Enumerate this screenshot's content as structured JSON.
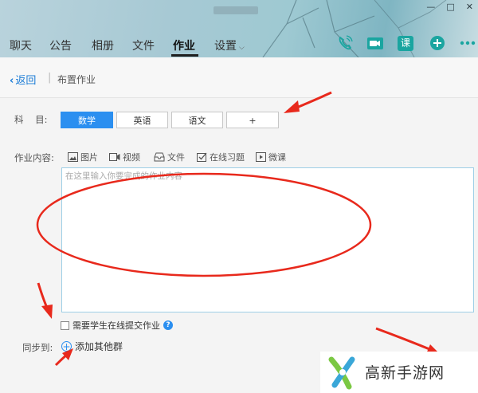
{
  "window": {
    "title_blurred": "",
    "controls": [
      "—",
      "□",
      "✕"
    ]
  },
  "nav": {
    "tabs": [
      {
        "label": "聊天"
      },
      {
        "label": "公告"
      },
      {
        "label": "相册"
      },
      {
        "label": "文件"
      },
      {
        "label": "作业"
      },
      {
        "label": "设置"
      }
    ],
    "active_tab": "作业",
    "tool_icons": [
      "phone-icon",
      "video-call-icon",
      "class-icon",
      "add-icon",
      "more-icon"
    ],
    "class_icon_label": "课"
  },
  "breadcrumb": {
    "back_label": "返回",
    "separator": "|",
    "title": "布置作业"
  },
  "form": {
    "subject_label": "科    目:",
    "subjects": [
      {
        "label": "数学",
        "active": true
      },
      {
        "label": "英语",
        "active": false
      },
      {
        "label": "语文",
        "active": false
      },
      {
        "label": "+",
        "active": false
      }
    ],
    "content_label": "作业内容:",
    "toolbar": [
      {
        "icon": "image-icon",
        "label": "图片"
      },
      {
        "icon": "video-icon",
        "label": "视频"
      },
      {
        "icon": "file-icon",
        "label": "文件"
      },
      {
        "icon": "exercise-icon",
        "label": "在线习题"
      },
      {
        "icon": "microclass-icon",
        "label": "微课"
      }
    ],
    "editor_placeholder": "在这里输入你要完成的作业内容",
    "require_online_label": "需要学生在线提交作业",
    "sync_label": "同步到:",
    "add_group_label": "添加其他群"
  },
  "watermark": {
    "text": "高新手游网"
  },
  "colors": {
    "accent": "#2b8ff0",
    "annotation": "#e8291c",
    "link": "#1a7bd6"
  }
}
